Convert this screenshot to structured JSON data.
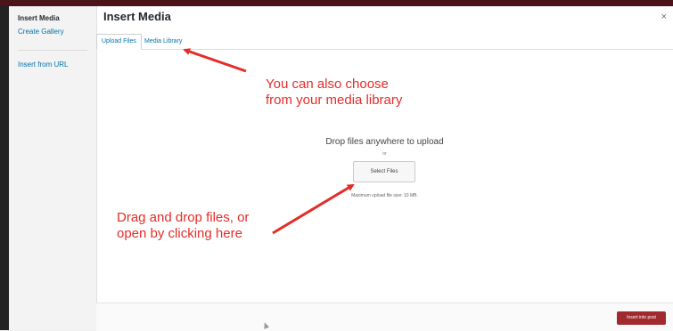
{
  "sidebar": {
    "title": "Insert Media",
    "links": [
      "Create Gallery",
      "Insert from URL"
    ]
  },
  "modal": {
    "title": "Insert Media",
    "close_label": "×",
    "tabs": [
      "Upload Files",
      "Media Library"
    ],
    "drop_title": "Drop files anywhere to upload",
    "or_text": "or",
    "select_button": "Select Files",
    "max_size": "Maximum upload file size: 10 MB.",
    "insert_button": "Insert into post"
  },
  "annotations": {
    "media_library_note": [
      "You can also choose",
      "from your media library"
    ],
    "drag_drop_note": [
      "Drag and drop files, or",
      "open by clicking here"
    ],
    "color": "#e32d28"
  }
}
